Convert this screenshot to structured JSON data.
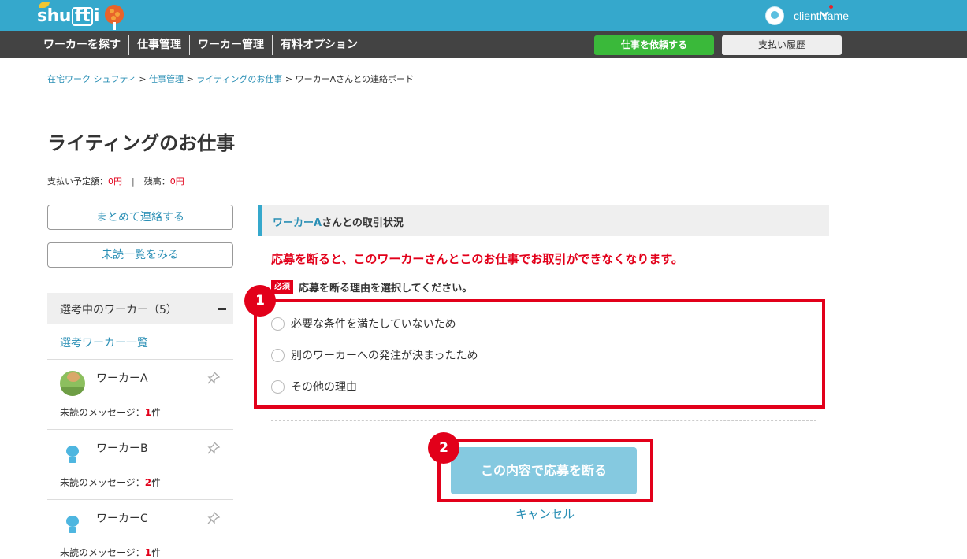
{
  "header": {
    "logo_text": "shufti",
    "user_name": "clientName"
  },
  "nav": {
    "items": [
      "ワーカーを探す",
      "仕事管理",
      "ワーカー管理",
      "有料オプション"
    ],
    "request_button": "仕事を依頼する",
    "history_button": "支払い履歴"
  },
  "breadcrumb": {
    "items": [
      "在宅ワーク シュフティ",
      "仕事管理",
      "ライティングのお仕事",
      "ワーカーAさんとの連絡ボード"
    ],
    "separator": ">"
  },
  "page": {
    "title": "ライティングのお仕事",
    "balance": {
      "scheduled_label": "支払い予定額：",
      "scheduled_value": "0円",
      "separator": "|",
      "remaining_label": "残高：",
      "remaining_value": "0円"
    }
  },
  "sidebar": {
    "bulk_contact_button": "まとめて連絡する",
    "unread_list_button": "未読一覧をみる",
    "section_label": "選考中のワーカー（5）",
    "section_toggle": "minus-icon",
    "worker_list_link": "選考ワーカー一覧",
    "unread_label": "未読のメッセージ：",
    "workers": [
      {
        "name": "ワーカーA",
        "unread_count": "1",
        "unread_unit": "件",
        "avatar": "photo"
      },
      {
        "name": "ワーカーB",
        "unread_count": "2",
        "unread_unit": "件",
        "avatar": "robot"
      },
      {
        "name": "ワーカーC",
        "unread_count": "1",
        "unread_unit": "件",
        "avatar": "robot"
      }
    ]
  },
  "main": {
    "status_bar": {
      "worker": "ワーカーA",
      "suffix": "さんとの取引状況"
    },
    "warning": "応募を断ると、このワーカーさんとこのお仕事でお取引ができなくなります。",
    "required_badge": "必須",
    "required_text": "応募を断る理由を選択してください。",
    "options": [
      "必要な条件を満たしていないため",
      "別のワーカーへの発注が決まったため",
      "その他の理由"
    ],
    "decline_button": "この内容で応募を断る",
    "cancel_link": "キャンセル"
  },
  "annotations": {
    "step1": "1",
    "step2": "2",
    "highlight_color": "#e2001a"
  },
  "colors": {
    "header_bg": "#35a8cc",
    "nav_bg": "#434343",
    "request_green": "#3ab93a",
    "link_blue": "#2a8fb5",
    "warning_red": "#e2001a",
    "decline_button_bg": "#85c9e0"
  }
}
